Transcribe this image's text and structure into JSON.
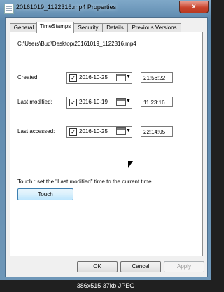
{
  "window": {
    "title": "20161019_1122316.mp4 Properties",
    "close_label": "x"
  },
  "tabs": [
    "General",
    "TimeStamps",
    "Security",
    "Details",
    "Previous Versions"
  ],
  "active_tab": "TimeStamps",
  "file_path": "C:\\Users\\Bud\\Desktop\\20161019_1122316.mp4",
  "rows": [
    {
      "label": "Created:",
      "checked": true,
      "check_mark": "✓",
      "date": "2016-10-25",
      "time": "21:56:22"
    },
    {
      "label": "Last modified:",
      "checked": true,
      "check_mark": "✓",
      "date": "2016-10-19",
      "time": "11:23:16"
    },
    {
      "label": "Last accessed:",
      "checked": true,
      "check_mark": "✓",
      "date": "2016-10-25",
      "time": "22:14:05"
    }
  ],
  "dropdown_glyph": "▼",
  "touch": {
    "description": "Touch : set the \"Last modified\" time to the current time",
    "button_label": "Touch"
  },
  "footer_buttons": {
    "ok": "OK",
    "cancel": "Cancel",
    "apply": "Apply"
  },
  "caption": "386x515 37kb JPEG"
}
